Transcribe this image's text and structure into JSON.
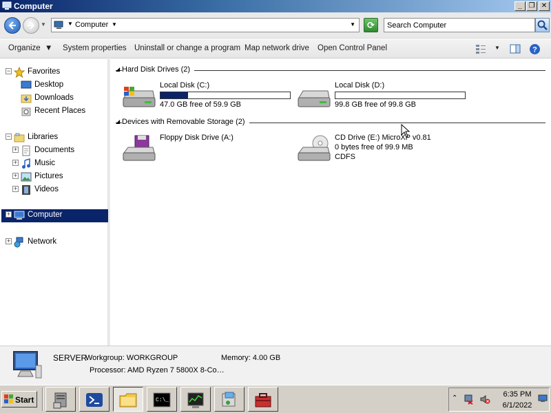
{
  "window": {
    "title": "Computer"
  },
  "address": {
    "crumb": "Computer",
    "search_placeholder": "Search Computer"
  },
  "toolbar": {
    "organize": "Organize",
    "system_properties": "System properties",
    "uninstall": "Uninstall or change a program",
    "map_drive": "Map network drive",
    "control_panel": "Open Control Panel"
  },
  "sidebar": {
    "favorites": "Favorites",
    "desktop": "Desktop",
    "downloads": "Downloads",
    "recent": "Recent Places",
    "libraries": "Libraries",
    "documents": "Documents",
    "music": "Music",
    "pictures": "Pictures",
    "videos": "Videos",
    "computer": "Computer",
    "network": "Network"
  },
  "groups": {
    "hdd": "Hard Disk Drives (2)",
    "removable": "Devices with Removable Storage (2)"
  },
  "drives": {
    "c": {
      "name": "Local Disk (C:)",
      "free": "47.0 GB free of 59.9 GB",
      "used_fraction": 0.215
    },
    "d": {
      "name": "Local Disk (D:)",
      "free": "99.8 GB free of 99.8 GB",
      "used_fraction": 0.0
    },
    "a": {
      "name": "Floppy Disk Drive (A:)"
    },
    "e": {
      "name": "CD Drive (E:) MicroXP v0.81",
      "free": "0 bytes free of 99.9 MB",
      "fs": "CDFS"
    }
  },
  "details": {
    "name": "SERVER",
    "workgroup": "Workgroup: WORKGROUP",
    "memory": "Memory: 4.00 GB",
    "processor": "Processor: AMD Ryzen 7 5800X 8-Co…"
  },
  "taskbar": {
    "start": "Start",
    "time": "6:35 PM",
    "date": "6/1/2022"
  },
  "colors": {
    "selection": "#0a246a",
    "titlebar": "#0a246a",
    "taskbar": "#d4d0c8"
  }
}
